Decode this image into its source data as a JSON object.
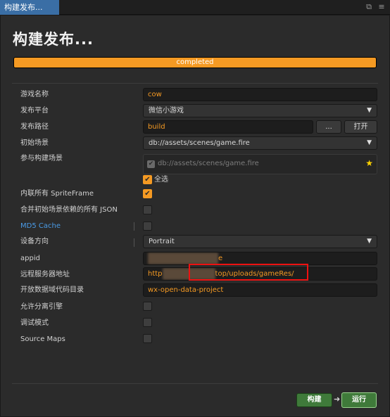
{
  "window": {
    "tab_title": "构建发布...",
    "page_title": "构建发布..."
  },
  "progress": {
    "text": "completed",
    "value": 1.0
  },
  "form": {
    "game_name": {
      "label": "游戏名称",
      "value": "cow"
    },
    "platform": {
      "label": "发布平台",
      "value": "微信小游戏"
    },
    "build_path": {
      "label": "发布路径",
      "value": "build",
      "browse_label": "...",
      "open_label": "打开"
    },
    "start_scene": {
      "label": "初始场景",
      "value": "db://assets/scenes/game.fire"
    },
    "included_scenes": {
      "label": "参与构建场景",
      "scene": "db://assets/scenes/game.fire",
      "select_all_label": "全选"
    },
    "inline_spriteframe": {
      "label": "内联所有 SpriteFrame",
      "checked": true
    },
    "merge_json": {
      "label": "合并初始场景依赖的所有 JSON",
      "checked": false
    },
    "md5_cache": {
      "label": "MD5 Cache",
      "checked": false
    },
    "orientation": {
      "label": "设备方向",
      "value": "Portrait"
    },
    "appid": {
      "label": "appid",
      "value_end": "e"
    },
    "remote_server": {
      "label": "远程服务器地址",
      "value_start": "http",
      "value_end": "top/uploads/gameRes/"
    },
    "open_data_dir": {
      "label": "开放数据域代码目录",
      "value": "wx-open-data-project"
    },
    "separate_engine": {
      "label": "允许分离引擎",
      "checked": false
    },
    "debug_mode": {
      "label": "调试模式",
      "checked": false
    },
    "source_maps": {
      "label": "Source Maps",
      "checked": false
    }
  },
  "footer": {
    "build_label": "构建",
    "run_label": "运行"
  },
  "colors": {
    "accent": "#f59a23",
    "link": "#4a9be6",
    "build_green": "#3f7a3a",
    "highlight_red": "#e11111"
  }
}
